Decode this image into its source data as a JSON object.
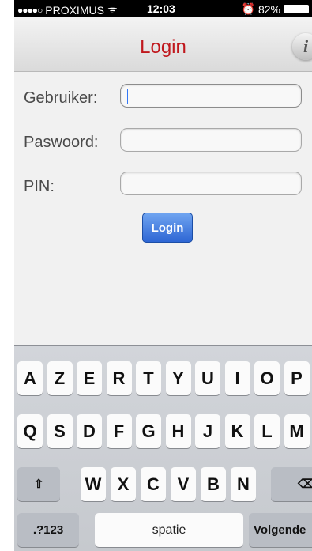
{
  "status_bar": {
    "signal": "●●●●○",
    "carrier": "PROXIMUS",
    "wifi": "ᯤ",
    "time": "12:03",
    "alarm": "⏰",
    "battery": "82%"
  },
  "nav": {
    "title": "Login",
    "info_icon": "i"
  },
  "form": {
    "user_label": "Gebruiker:",
    "user_value": "",
    "password_label": "Paswoord:",
    "password_value": "",
    "pin_label": "PIN:",
    "pin_value": "",
    "login_button": "Login"
  },
  "keyboard": {
    "row1": [
      "A",
      "Z",
      "E",
      "R",
      "T",
      "Y",
      "U",
      "I",
      "O",
      "P"
    ],
    "row2": [
      "Q",
      "S",
      "D",
      "F",
      "G",
      "H",
      "J",
      "K",
      "L",
      "M"
    ],
    "row3": [
      "W",
      "X",
      "C",
      "V",
      "B",
      "N"
    ],
    "shift_icon": "⇧",
    "backspace_icon": "⌫",
    "numbers_key": ".?123",
    "space_key": "spatie",
    "next_key": "Volgende"
  },
  "colors": {
    "title": "#c0181d",
    "button": "#2e66d4"
  }
}
